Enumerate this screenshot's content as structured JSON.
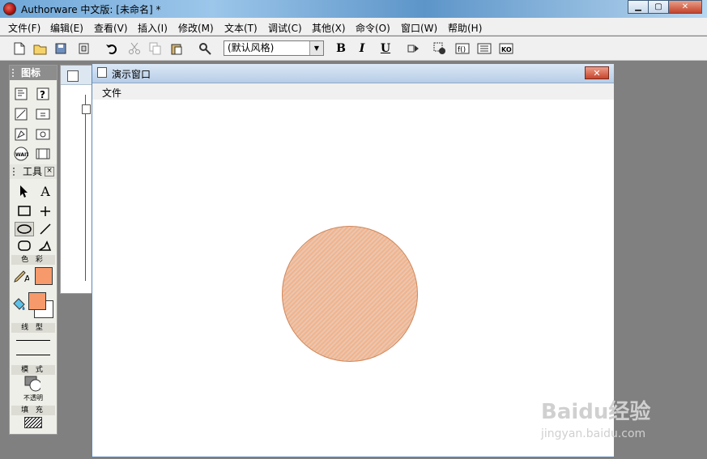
{
  "window": {
    "title": "Authorware 中文版: [未命名] *"
  },
  "menu": [
    "文件(F)",
    "编辑(E)",
    "查看(V)",
    "插入(I)",
    "修改(M)",
    "文本(T)",
    "调试(C)",
    "其他(X)",
    "命令(O)",
    "窗口(W)",
    "帮助(H)"
  ],
  "toolbar": {
    "style_select": "(默认风格)",
    "bold": "B",
    "italic": "I",
    "underline": "U"
  },
  "palette": {
    "icons_title": "图标",
    "tools_title": "工具",
    "color_label": "色 彩",
    "line_label": "线 型",
    "mode_label": "模 式",
    "mode_value": "不透明",
    "fill_label": "填 充"
  },
  "presentation": {
    "title": "演示窗口",
    "menu_file": "文件",
    "circle_fill": "#f2b38c",
    "circle_stroke": "#d0865a"
  },
  "watermark": {
    "brand": "Baidu经验",
    "url": "jingyan.baidu.com"
  },
  "colors": {
    "fill_swatch": "#f79a6b",
    "titlebar": "#6fa7d8"
  }
}
